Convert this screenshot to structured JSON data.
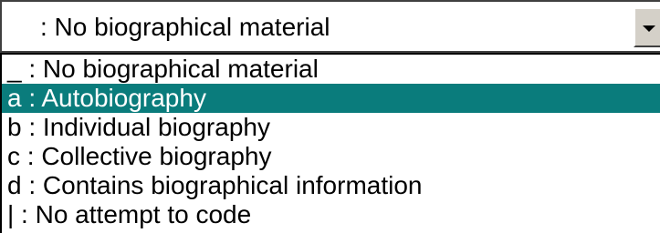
{
  "combo": {
    "selected_value": " : No biographical material"
  },
  "list": {
    "items": [
      {
        "label": "_ : No biographical material",
        "selected": false
      },
      {
        "label": "a : Autobiography",
        "selected": true
      },
      {
        "label": "b : Individual biography",
        "selected": false
      },
      {
        "label": "c : Collective biography",
        "selected": false
      },
      {
        "label": "d : Contains biographical information",
        "selected": false
      },
      {
        "label": "| : No attempt to code",
        "selected": false
      }
    ]
  },
  "colors": {
    "selection_background": "#0a7c7c",
    "selection_text": "#ffffff",
    "button_face": "#d4d0c8"
  },
  "icons": {
    "dropdown": "chevron-down-icon"
  }
}
